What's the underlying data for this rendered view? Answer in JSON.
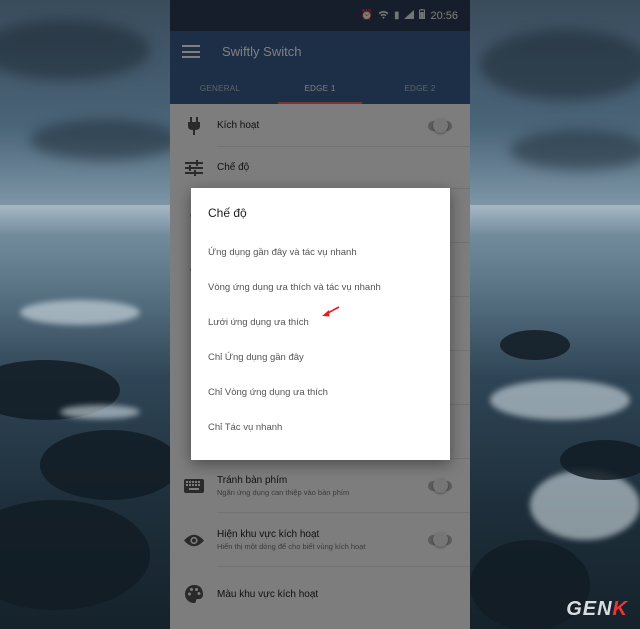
{
  "statusbar": {
    "time": "20:56"
  },
  "app": {
    "title": "Swiftly Switch"
  },
  "tabs": [
    {
      "label": "GENERAL"
    },
    {
      "label": "EDGE 1"
    },
    {
      "label": "EDGE 2"
    }
  ],
  "settings": [
    {
      "title": "Kích hoạt",
      "icon": "plug-icon"
    },
    {
      "title": "Chế độ",
      "icon": "sliders-icon"
    },
    {
      "title": "Tránh bàn phím",
      "subtitle": "Ngăn ứng dụng can thiệp vào bàn phím",
      "icon": "keyboard-icon"
    },
    {
      "title": "Hiện khu vực kích hoạt",
      "subtitle": "Hiển thị một dòng để cho biết vùng kích hoạt",
      "icon": "eye-icon"
    },
    {
      "title": "Màu khu vực kích hoạt",
      "icon": "palette-icon"
    }
  ],
  "dialog": {
    "title": "Chế độ",
    "options": [
      "Ứng dụng gần đây và tác vụ nhanh",
      "Vòng ứng dụng ưa thích và tác vụ nhanh",
      "Lưới ứng dụng ưa thích",
      "Chỉ Ứng dụng gần đây",
      "Chỉ Vòng ứng dụng ưa thích",
      "Chỉ Tác vụ nhanh"
    ]
  },
  "watermark": {
    "text_main": "GEN",
    "text_accent": "K"
  },
  "colors": {
    "appbar": "#3b5f8c",
    "tab_indicator": "#f06a6a",
    "arrow": "#e02020"
  }
}
